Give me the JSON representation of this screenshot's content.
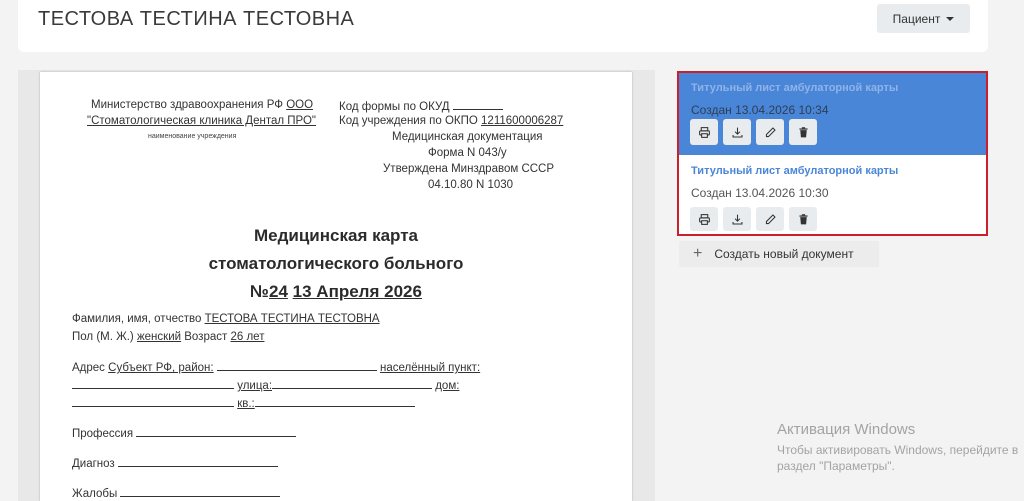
{
  "header": {
    "title": "ТЕСТОВА ТЕСТИНА ТЕСТОВНА",
    "patient_button": "Пациент"
  },
  "document": {
    "ministry": "Министерство здравоохранения РФ",
    "org_prefix": "ООО",
    "org_name": "\"Стоматологическая клиника Дентал ПРО\"",
    "org_caption": "наименование учреждения",
    "okud_label": "Код формы по ОКУД",
    "okpo_label": "Код учреждения по ОКПО",
    "okpo_value": "1211600006287",
    "med_doc": "Медицинская документация",
    "form_no": "Форма N 043/у",
    "approved": "Утверждена Минздравом СССР",
    "approved_date": "04.10.80 N 1030",
    "title_line1": "Медицинская карта",
    "title_line2": "стоматологического больного",
    "number_prefix": "№",
    "number_value": "24",
    "number_date": "13 Апреля 2026",
    "fio_label": "Фамилия, имя, отчество",
    "fio_value": "ТЕСТОВА ТЕСТИНА ТЕСТОВНА",
    "sex_label": "Пол (М. Ж.)",
    "sex_value": "женский",
    "age_label": "Возраст",
    "age_value": "26 лет",
    "address_label": "Адрес",
    "region_label": "Субъект РФ, район:",
    "locality_label": "населённый пункт:",
    "street_label": "улица:",
    "house_label": "дом:",
    "apt_label": "кв.:",
    "profession_label": "Профессия",
    "diagnosis_label": "Диагноз",
    "complaints_label": "Жалобы"
  },
  "documents": [
    {
      "name": "Титульный лист амбулаторной карты",
      "created": "Создан 13.04.2026 10:34",
      "active": true
    },
    {
      "name": "Титульный лист амбулаторной карты",
      "created": "Создан 13.04.2026 10:30",
      "active": false
    }
  ],
  "actions": {
    "icons": [
      "print-icon",
      "download-icon",
      "edit-icon",
      "delete-icon"
    ]
  },
  "new_document": {
    "label": "Создать новый документ"
  },
  "watermark": {
    "title": "Активация Windows",
    "line1": "Чтобы активировать Windows, перейдите в",
    "line2": "раздел \"Параметры\"."
  },
  "colors": {
    "active_item": "#4a86d8",
    "highlight_border": "#cc1f2d",
    "button_bg": "#e9ecef"
  }
}
